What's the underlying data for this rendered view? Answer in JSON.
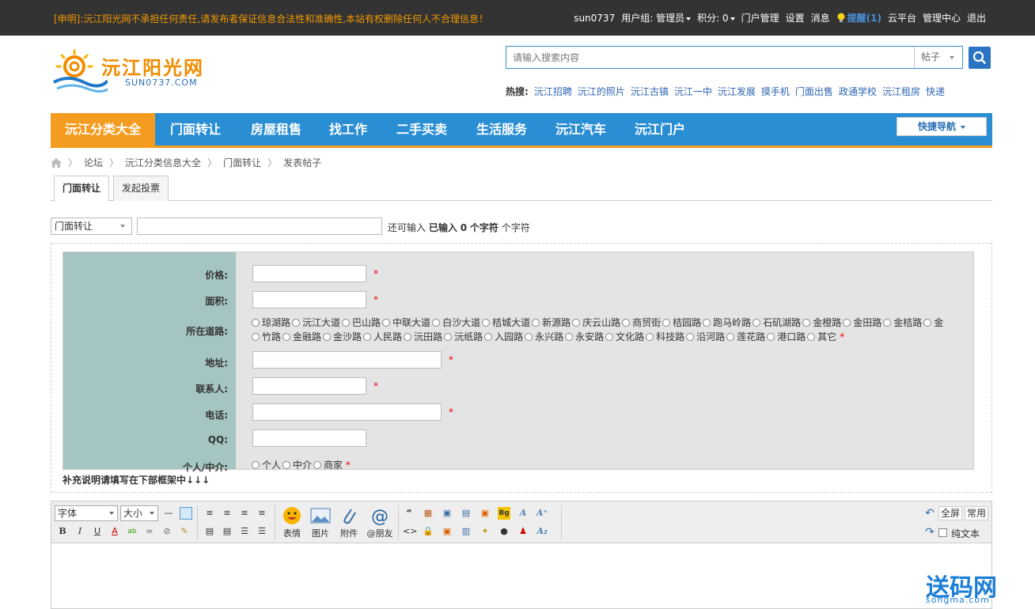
{
  "topbar": {
    "notice": "[申明]:沅江阳光网不承担任何责任,请发布者保证信息合法性和准确性,本站有权删除任何人不合理信息！",
    "username": "sun0737",
    "usergroup": "用户组: 管理员",
    "points": "积分: 0",
    "links": [
      "门户管理",
      "设置",
      "消息"
    ],
    "alert": "提醒(1)",
    "links2": [
      "云平台",
      "管理中心",
      "退出"
    ]
  },
  "logo": {
    "name": "沅江阳光网",
    "domain": "SUN0737.COM"
  },
  "search": {
    "placeholder": "请输入搜索内容",
    "type": "帖子"
  },
  "hot": {
    "label": "热搜:",
    "items": [
      "沅江招聘",
      "沅江的照片",
      "沅江古镇",
      "沅江一中",
      "沅江发展",
      "摸手机",
      "门面出售",
      "政通学校",
      "沅江租房",
      "快递"
    ]
  },
  "nav": {
    "items": [
      "沅江分类大全",
      "门面转让",
      "房屋租售",
      "找工作",
      "二手买卖",
      "生活服务",
      "沅江汽车",
      "沅江门户"
    ],
    "quick": "快捷导航"
  },
  "breadcrumb": [
    "论坛",
    "沅江分类信息大全",
    "门面转让",
    "发表帖子"
  ],
  "tabs": [
    "门面转让",
    "发起投票"
  ],
  "post": {
    "type": "门面转让",
    "count_prefix": "还可输入",
    "count_mid": "已输入",
    "count_num": "0",
    "count_unit": "个字符",
    "count_suffix": "个字符"
  },
  "form": {
    "price_label": "价格:",
    "area_label": "面积:",
    "road_label": "所在道路:",
    "roads_line1": [
      "琼湖路",
      "沅江大道",
      "巴山路",
      "中联大道",
      "白沙大道",
      "桔城大道",
      "新源路",
      "庆云山路",
      "商贸街",
      "桔园路",
      "跑马岭路",
      "石矶湖路",
      "金橙路",
      "金田路",
      "金桔路",
      "金"
    ],
    "roads_line2": [
      "竹路",
      "金融路",
      "金沙路",
      "人民路",
      "沅田路",
      "沅纸路",
      "入园路",
      "永兴路",
      "永安路",
      "文化路",
      "科技路",
      "沿河路",
      "莲花路",
      "港口路",
      "其它"
    ],
    "address_label": "地址:",
    "contact_label": "联系人:",
    "phone_label": "电话:",
    "qq_label": "QQ:",
    "role_label": "个人/中介:",
    "roles": [
      "个人",
      "中介",
      "商家"
    ],
    "required": "*",
    "supplement": "补充说明请填写在下部框架中↓↓↓"
  },
  "editor": {
    "font": "字体",
    "size": "大小",
    "big_buttons": [
      "表情",
      "图片",
      "附件",
      "@朋友"
    ],
    "fullscreen": "全屏",
    "common": "常用",
    "plaintext": "纯文本"
  },
  "watermark": {
    "text": "送码网",
    "domain": "songma.com"
  },
  "colors": {
    "nav": "#2a8ed4",
    "accent": "#f49c1f",
    "label_bg": "#a4c5c1"
  }
}
